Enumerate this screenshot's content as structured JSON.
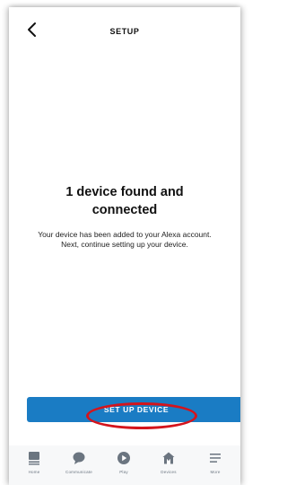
{
  "header": {
    "title": "SETUP",
    "back_icon": "chevron-left-icon"
  },
  "main": {
    "headline": "1 device found and connected",
    "body": "Your device has been added to your Alexa account. Next, continue setting up your device."
  },
  "cta": {
    "label": "SET UP DEVICE",
    "color": "#1a7cc4"
  },
  "annotation": {
    "shape": "ellipse",
    "color": "#d4141c"
  },
  "tabbar": {
    "items": [
      {
        "label": "Home",
        "icon": "home-icon"
      },
      {
        "label": "Communicate",
        "icon": "chat-bubble-icon"
      },
      {
        "label": "Play",
        "icon": "play-icon"
      },
      {
        "label": "Devices",
        "icon": "house-icon"
      },
      {
        "label": "More",
        "icon": "menu-icon"
      }
    ]
  }
}
